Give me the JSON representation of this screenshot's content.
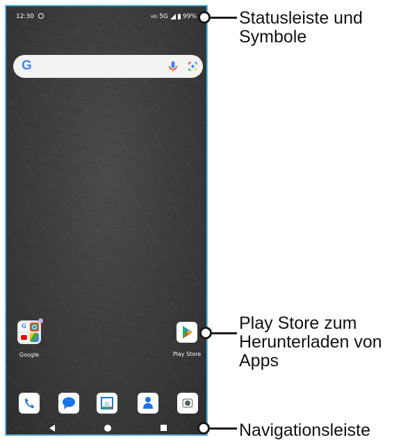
{
  "status_bar": {
    "time": "12:30",
    "hd": "HD",
    "network": "5G",
    "battery": "99%"
  },
  "search": {
    "logo": "G",
    "icons": [
      "mic-icon",
      "lens-icon"
    ]
  },
  "apps": {
    "google_folder": {
      "label": "Google",
      "icons": [
        "google-icon",
        "chrome-icon",
        "youtube-icon",
        "drive-icon"
      ]
    },
    "play_store": {
      "label": "Play Store"
    }
  },
  "dock": {
    "icons": [
      "phone-icon",
      "messages-icon",
      "calendar-icon",
      "contacts-icon",
      "camera-icon"
    ],
    "calendar_day": "31"
  },
  "nav": {
    "icons": [
      "back-icon",
      "home-icon",
      "recents-icon"
    ]
  },
  "callouts": {
    "status": [
      "Statusleiste und",
      "Symbole"
    ],
    "play_store": [
      "Play Store zum",
      "Herunterladen von",
      "Apps"
    ],
    "nav": [
      "Navigationsleiste"
    ]
  },
  "colors": {
    "frame": "#58b4e4",
    "wallpaper": "#3b3b3b",
    "search_bar": "#f3f3f1"
  }
}
